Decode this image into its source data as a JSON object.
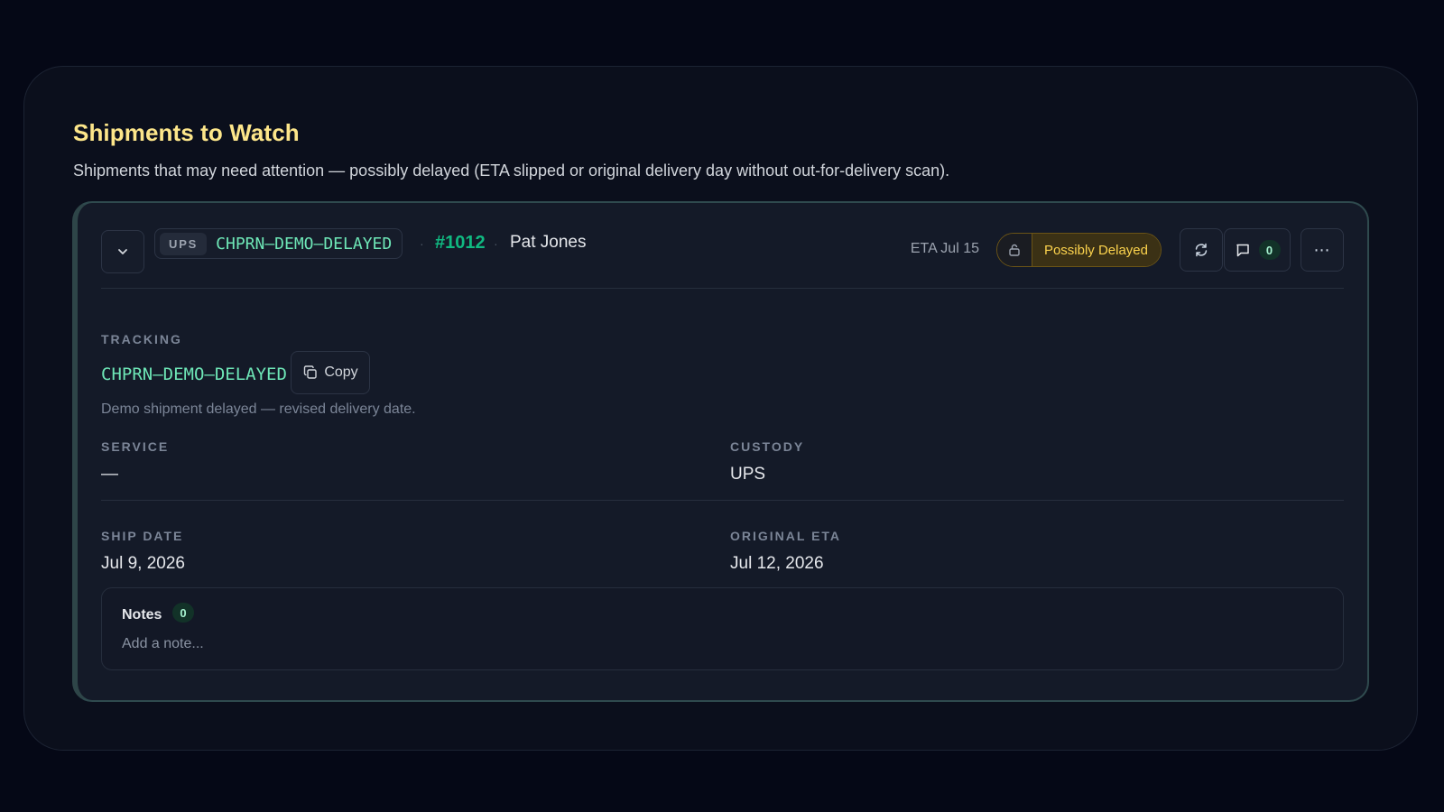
{
  "section": {
    "title": "Shipments to Watch",
    "description": "Shipments that may need attention — possibly delayed (ETA slipped or original delivery day without out-for-delivery scan)."
  },
  "shipment": {
    "carrier": "UPS",
    "tracking_number": "CHPRN–DEMO–DELAYED",
    "order_number": "#1012",
    "customer_name": "Pat Jones",
    "separator": "·",
    "eta_label": "ETA Jul 15",
    "status": "Possibly Delayed",
    "comment_count": "0",
    "more_label": "⋯",
    "icons": {
      "expand": "chevron-down-icon",
      "lock": "unlock-icon",
      "refresh": "refresh-icon",
      "comment": "comment-icon",
      "copy": "copy-icon"
    },
    "colors": {
      "accent": "#10b981",
      "tracking": "#6ee7b7",
      "title": "#fde68a",
      "status_text": "#fcd34d",
      "status_bg": "#3b3115"
    }
  },
  "details": {
    "tracking_label": "Tracking",
    "tracking_value": "CHPRN–DEMO–DELAYED",
    "copy_label": "Copy",
    "tracking_message": "Demo shipment delayed — revised delivery date.",
    "service_label": "Service",
    "service_value": "—",
    "custody_label": "Custody",
    "custody_value": "UPS",
    "ship_date_label": "Ship Date",
    "ship_date_value": "Jul 9, 2026",
    "original_eta_label": "Original ETA",
    "original_eta_value": "Jul 12, 2026"
  },
  "notes": {
    "title": "Notes",
    "count": "0",
    "placeholder": "Add a note..."
  }
}
